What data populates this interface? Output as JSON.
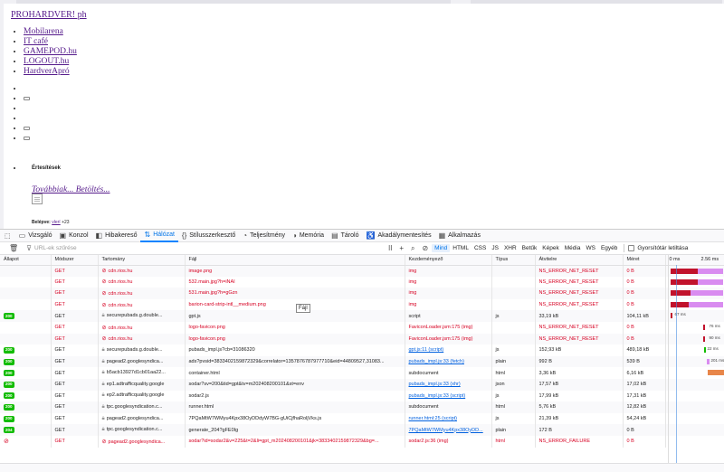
{
  "page": {
    "brand": "PROHARDVER! ph",
    "links": [
      "Mobilarena",
      "IT café",
      "GAMEPOD.hu",
      "LOGOUT.hu",
      "HardverApró"
    ],
    "notifications_title": "Értesítések",
    "more_loading": "Továbbiak... Betöltés...",
    "logged_in_prefix": "Belépve:",
    "logged_in_user": "vlerí",
    "logged_in_suffix": "+23"
  },
  "devtools": {
    "tabs": [
      {
        "label": "Vizsgáló",
        "icon": "▭",
        "name": "tab-inspector"
      },
      {
        "label": "Konzol",
        "icon": "▣",
        "name": "tab-console"
      },
      {
        "label": "Hibakereső",
        "icon": "◧",
        "name": "tab-debugger"
      },
      {
        "label": "Hálózat",
        "icon": "⇅",
        "name": "tab-network",
        "active": true
      },
      {
        "label": "Stílusszerkesztő",
        "icon": "{}",
        "name": "tab-style-editor"
      },
      {
        "label": "Teljesítmény",
        "icon": "◔",
        "name": "tab-performance"
      },
      {
        "label": "Memória",
        "icon": "◑",
        "name": "tab-memory"
      },
      {
        "label": "Tároló",
        "icon": "▤",
        "name": "tab-storage"
      },
      {
        "label": "Akadálymentesítés",
        "icon": "♿",
        "name": "tab-accessibility"
      },
      {
        "label": "Alkalmazás",
        "icon": "▦",
        "name": "tab-application"
      }
    ],
    "toolbar": {
      "filter_placeholder": "URL-ek szűrése",
      "types": [
        "Mind",
        "HTML",
        "CSS",
        "JS",
        "XHR",
        "Betűk",
        "Képek",
        "Média",
        "WS",
        "Egyéb"
      ],
      "active_type": "Mind",
      "disable_cache_label": "Gyorsítótár letiltása"
    },
    "columns": [
      "Állapot",
      "Módszer",
      "Tartomány",
      "Fájl",
      "Kezdeményező",
      "Típus",
      "Átvitelre",
      "Méret",
      "0 ms",
      "2.56 ms"
    ],
    "tooltip": "Fájl",
    "timeline_colors": {
      "blocked": "#c1122c",
      "wait": "#d98cf0",
      "receive": "#e8864a"
    },
    "rows": [
      {
        "status": "",
        "err": true,
        "method": "GET",
        "domain": "cdn.rios.hu",
        "file": "image.png",
        "initiator": "img",
        "init_link": false,
        "type": "",
        "transferred": "NS_ERROR_NET_RESET",
        "size": "0 B",
        "timeline": ""
      },
      {
        "status": "",
        "err": true,
        "method": "GET",
        "domain": "cdn.rios.hu",
        "file": "532.main.jpg?h=iNAI",
        "initiator": "img",
        "init_link": false,
        "type": "",
        "transferred": "NS_ERROR_NET_RESET",
        "size": "0 B",
        "timeline": ""
      },
      {
        "status": "",
        "err": true,
        "method": "GET",
        "domain": "cdn.rios.hu",
        "file": "531.main.jpg?h=gGzn",
        "initiator": "img",
        "init_link": false,
        "type": "",
        "transferred": "NS_ERROR_NET_RESET",
        "size": "0 B",
        "timeline": ""
      },
      {
        "status": "",
        "err": true,
        "method": "GET",
        "domain": "cdn.rios.hu",
        "file": "barion-card-strip-intl__medium.png",
        "initiator": "img",
        "init_link": false,
        "type": "",
        "transferred": "NS_ERROR_NET_RESET",
        "size": "0 B",
        "timeline": ""
      },
      {
        "status": "200",
        "err": false,
        "method": "GET",
        "domain": "securepubads.g.double...",
        "file": "gpt.js",
        "initiator": "script",
        "init_link": false,
        "type": "js",
        "transferred": "33,19 kB",
        "size": "104,11 kB",
        "timeline": "67 ms"
      },
      {
        "status": "",
        "err": true,
        "method": "GET",
        "domain": "cdn.rios.hu",
        "file": "logo-favicon.png",
        "initiator": "FaviconLoader.jsm:175 (img)",
        "init_link": true,
        "type": "",
        "transferred": "NS_ERROR_NET_RESET",
        "size": "0 B",
        "timeline": "76 ms"
      },
      {
        "status": "",
        "err": true,
        "method": "GET",
        "domain": "cdn.rios.hu",
        "file": "logo-favicon.png",
        "initiator": "FaviconLoader.jsm:175 (img)",
        "init_link": true,
        "type": "",
        "transferred": "NS_ERROR_NET_RESET",
        "size": "0 B",
        "timeline": "90 ms"
      },
      {
        "status": "200",
        "err": false,
        "method": "GET",
        "domain": "securepubads.g.double...",
        "file": "pubads_impl.js?cb=31086320",
        "initiator": "gpt.js:11 (script)",
        "init_link": true,
        "type": "js",
        "transferred": "152,93 kB",
        "size": "489,18 kB",
        "timeline": "22 ms"
      },
      {
        "status": "200",
        "err": false,
        "method": "GET",
        "domain": "pagead2.googlesyndica...",
        "file": "ads?pvsid=3833402159872329&correlator=1357876787977710&eid=44809527,31083...",
        "initiator": "pubads_impl.js:33 (fetch)",
        "init_link": true,
        "type": "plain",
        "transferred": "992 B",
        "size": "539 B",
        "timeline": "201 ms"
      },
      {
        "status": "200",
        "err": false,
        "method": "GET",
        "domain": "b5acb13927d1cb01aa22...",
        "file": "container.html",
        "initiator": "subdocument",
        "init_link": false,
        "type": "html",
        "transferred": "3,36 kB",
        "size": "6,16 kB",
        "timeline": ""
      },
      {
        "status": "200",
        "err": false,
        "method": "GET",
        "domain": "ep1.adtrafficquality.google",
        "file": "sodar?sv=200&tid=gpt&tv=m202408200101&st=env",
        "initiator": "pubads_impl.js:33 (xhr)",
        "init_link": true,
        "type": "json",
        "transferred": "17,57 kB",
        "size": "17,02 kB",
        "timeline": ""
      },
      {
        "status": "200",
        "err": false,
        "method": "GET",
        "domain": "ep2.adtrafficquality.google",
        "file": "sodar2.js",
        "initiator": "pubads_impl.js:33 (script)",
        "init_link": true,
        "type": "js",
        "transferred": "17,99 kB",
        "size": "17,31 kB",
        "timeline": ""
      },
      {
        "status": "200",
        "err": false,
        "method": "GET",
        "domain": "tpc.googlesyndication.c...",
        "file": "runner.html",
        "initiator": "subdocument",
        "init_link": false,
        "type": "html",
        "transferred": "5,76 kB",
        "size": "12,82 kB",
        "timeline": ""
      },
      {
        "status": "200",
        "err": false,
        "method": "GET",
        "domain": "pagead2.googlesyndica...",
        "file": "7PQaMtW7WMyu4Kpx38OyDDdyW7BG-gUiCjfhaRoljVks.js",
        "initiator": "runner.html:25 (script)",
        "init_link": true,
        "type": "js",
        "transferred": "21,39 kB",
        "size": "54,24 kB",
        "timeline": ""
      },
      {
        "status": "204",
        "err": false,
        "method": "GET",
        "domain": "tpc.googlesyndication.c...",
        "file": "generate_204?gFE0Ig",
        "initiator": "7PQaMtW7WMyu4Kpx38OyDD...",
        "init_link": true,
        "type": "plain",
        "transferred": "172 B",
        "size": "0 B",
        "timeline": ""
      },
      {
        "status": "blocked",
        "err": true,
        "method": "GET",
        "domain": "pagead2.googlesyndica...",
        "file": "sodar?id=sodar2&v=225&t=2&li=gpt_m202408200101&jk=3833402159872329&bg=...",
        "initiator": "sodar2.js:36 (img)",
        "init_link": true,
        "type": "html",
        "transferred": "NS_ERROR_FAILURE",
        "size": "0 B",
        "timeline": ""
      }
    ]
  }
}
